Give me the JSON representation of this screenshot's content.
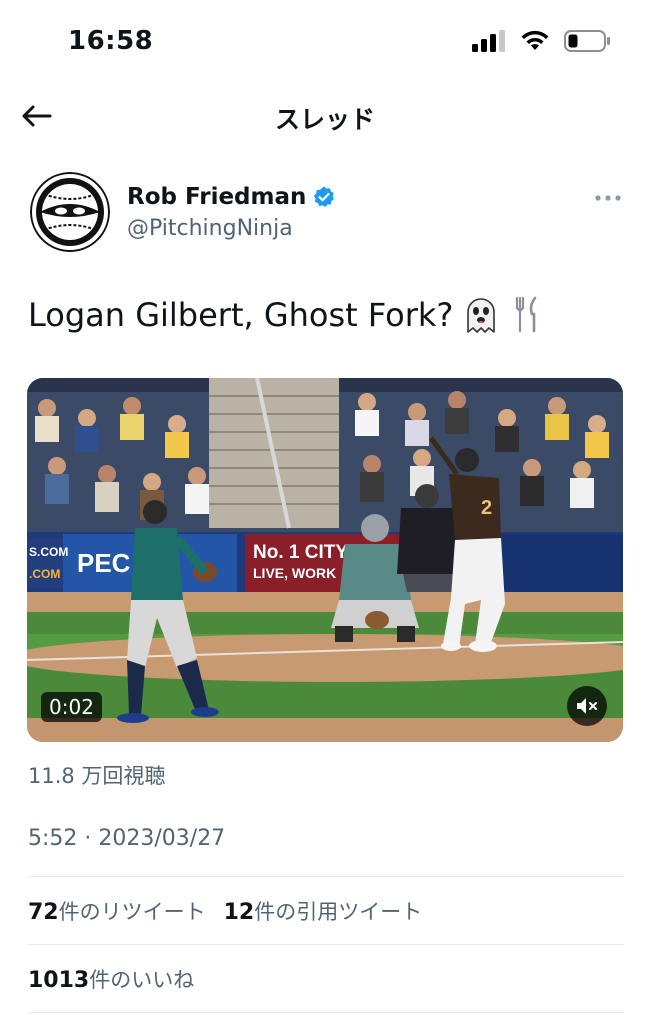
{
  "status_bar": {
    "time": "16:58"
  },
  "nav": {
    "title": "スレッド"
  },
  "author": {
    "name": "Rob Friedman",
    "handle": "@PitchingNinja",
    "verified": true
  },
  "tweet": {
    "text": "Logan Gilbert, Ghost Fork?",
    "emojis": [
      "ghost-emoji",
      "fork-and-knife-emoji"
    ]
  },
  "media": {
    "duration": "0:02",
    "banner_left": "PEC",
    "banner_center": "No. 1 CITY",
    "banner_center_sub": "LIVE, WORK",
    "banner_small_1": "S.COM",
    "banner_small_2": ".COM",
    "jersey_number": "2",
    "field_color": "#4a8a3a",
    "dirt_color": "#c79a72"
  },
  "meta": {
    "views": "11.8 万回視聴",
    "timestamp": "5:52 · 2023/03/27"
  },
  "stats": {
    "retweets_count": "72",
    "retweets_label": "件のリツイート",
    "quotes_count": "12",
    "quotes_label": "件の引用ツイート",
    "likes_count": "1013",
    "likes_label": "件のいいね"
  },
  "colors": {
    "verified": "#1d9bf0",
    "secondary_text": "#536471",
    "divider": "#e6e9ec"
  }
}
